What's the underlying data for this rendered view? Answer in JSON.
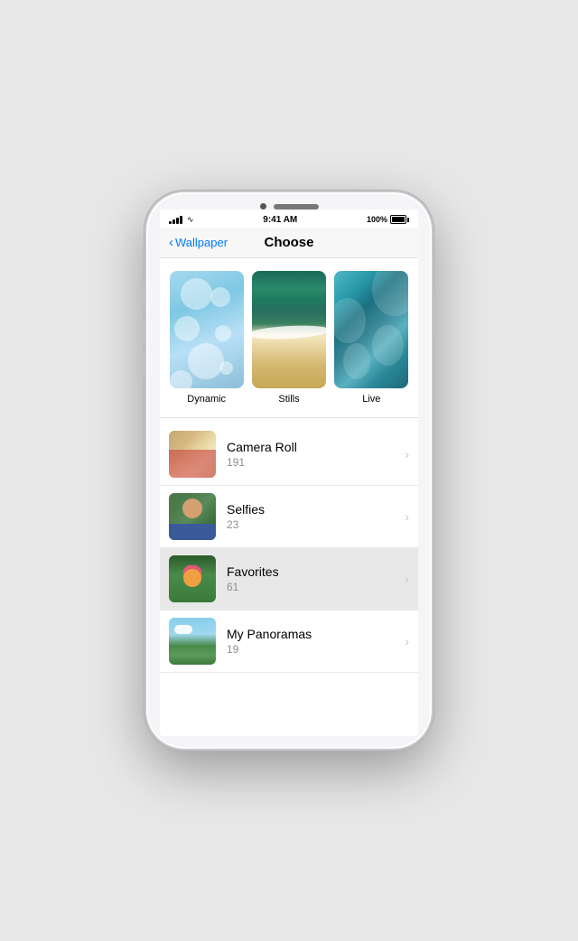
{
  "phone": {
    "status_bar": {
      "time": "9:41 AM",
      "battery_percent": "100%"
    }
  },
  "nav": {
    "back_label": "Wallpaper",
    "title": "Choose"
  },
  "wallpaper_grid": {
    "items": [
      {
        "id": "dynamic",
        "label": "Dynamic"
      },
      {
        "id": "stills",
        "label": "Stills"
      },
      {
        "id": "live",
        "label": "Live"
      }
    ]
  },
  "list_items": [
    {
      "id": "camera-roll",
      "title": "Camera Roll",
      "count": "191"
    },
    {
      "id": "selfies",
      "title": "Selfies",
      "count": "23"
    },
    {
      "id": "favorites",
      "title": "Favorites",
      "count": "61",
      "highlighted": true
    },
    {
      "id": "panoramas",
      "title": "My Panoramas",
      "count": "19"
    }
  ],
  "chevron_char": "›",
  "back_chevron_char": "‹"
}
